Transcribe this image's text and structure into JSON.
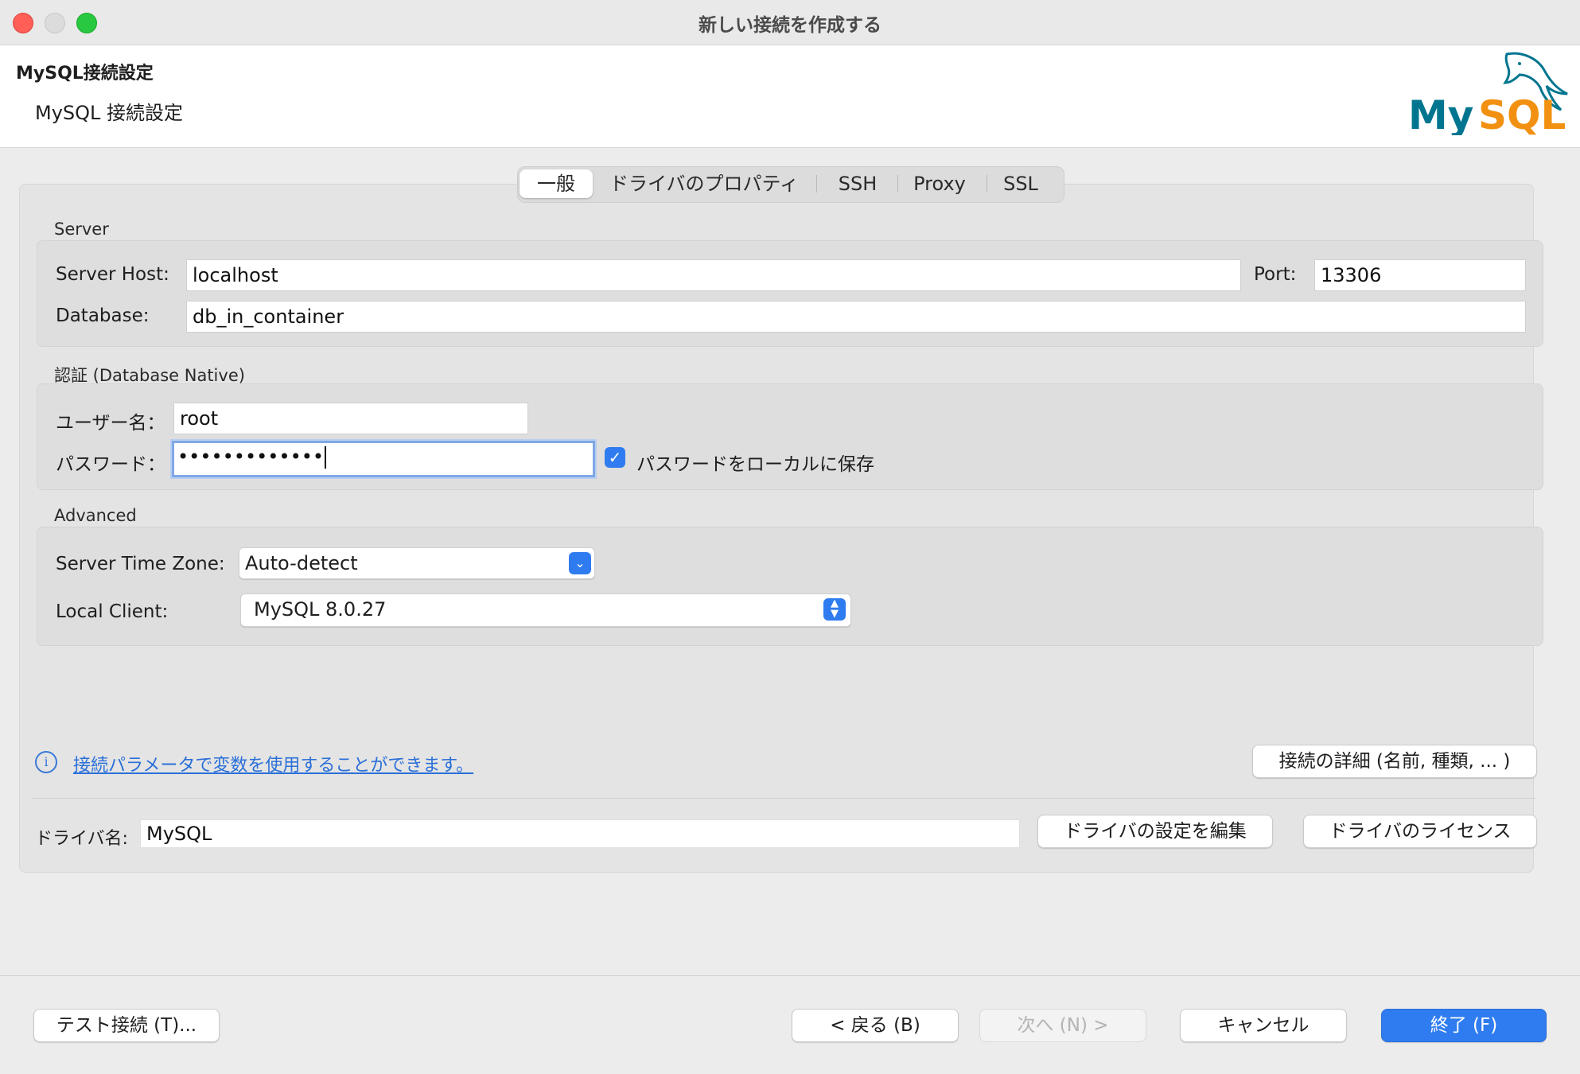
{
  "window": {
    "title": "新しい接続を作成する"
  },
  "header": {
    "title": "MySQL接続設定",
    "subtitle": "MySQL 接続設定",
    "logo_text": "MySQL"
  },
  "tabs": [
    {
      "label": "一般",
      "active": true
    },
    {
      "label": "ドライバのプロパティ",
      "active": false
    },
    {
      "label": "SSH",
      "active": false
    },
    {
      "label": "Proxy",
      "active": false
    },
    {
      "label": "SSL",
      "active": false
    }
  ],
  "server": {
    "group_label": "Server",
    "host_label": "Server Host:",
    "host_value": "localhost",
    "port_label": "Port:",
    "port_value": "13306",
    "database_label": "Database:",
    "database_value": "db_in_container"
  },
  "auth": {
    "group_label": "認証 (Database Native)",
    "user_label": "ユーザー名：",
    "user_value": "root",
    "password_label": "パスワード：",
    "password_value": "•••••••••••••",
    "save_password_label": "パスワードをローカルに保存",
    "save_password_checked": true
  },
  "advanced": {
    "group_label": "Advanced",
    "timezone_label": "Server Time Zone:",
    "timezone_value": "Auto-detect",
    "client_label": "Local Client:",
    "client_value": "MySQL 8.0.27"
  },
  "info_link": "接続パラメータで変数を使用することができます。",
  "details_button": "接続の詳細 (名前, 種類, ... )",
  "driver": {
    "label": "ドライバ名:",
    "value": "MySQL",
    "edit_button": "ドライバの設定を編集",
    "license_button": "ドライバのライセンス"
  },
  "footer": {
    "test_button": "テスト接続 (T)...",
    "back_button": "< 戻る (B)",
    "next_button": "次へ (N) >",
    "cancel_button": "キャンセル",
    "finish_button": "終了 (F)"
  },
  "colors": {
    "accent": "#2f7cf0",
    "logo_teal": "#00758f",
    "logo_orange": "#f29111"
  }
}
